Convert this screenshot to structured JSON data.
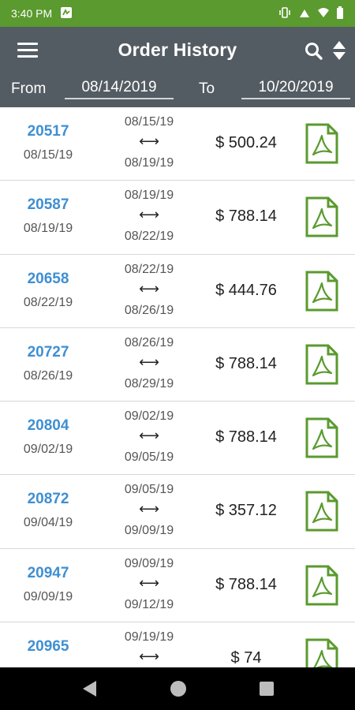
{
  "status_bar": {
    "time": "3:40 PM",
    "icons": [
      "app-notification-icon",
      "vibrate-icon",
      "signal-icon",
      "wifi-icon",
      "battery-icon"
    ]
  },
  "app_bar": {
    "title": "Order History",
    "icons": [
      "menu-icon",
      "search-icon",
      "sort-icon"
    ]
  },
  "filter": {
    "from_label": "From",
    "from_value": "08/14/2019",
    "to_label": "To",
    "to_value": "10/20/2019"
  },
  "orders": [
    {
      "number": "20517",
      "date": "08/15/19",
      "start": "08/15/19",
      "arrow": "⟷",
      "end": "08/19/19",
      "amount": "$ 500.24"
    },
    {
      "number": "20587",
      "date": "08/19/19",
      "start": "08/19/19",
      "arrow": "⟷",
      "end": "08/22/19",
      "amount": "$ 788.14"
    },
    {
      "number": "20658",
      "date": "08/22/19",
      "start": "08/22/19",
      "arrow": "⟷",
      "end": "08/26/19",
      "amount": "$ 444.76"
    },
    {
      "number": "20727",
      "date": "08/26/19",
      "start": "08/26/19",
      "arrow": "⟷",
      "end": "08/29/19",
      "amount": "$ 788.14"
    },
    {
      "number": "20804",
      "date": "09/02/19",
      "start": "09/02/19",
      "arrow": "⟷",
      "end": "09/05/19",
      "amount": "$ 788.14"
    },
    {
      "number": "20872",
      "date": "09/04/19",
      "start": "09/05/19",
      "arrow": "⟷",
      "end": "09/09/19",
      "amount": "$ 357.12"
    },
    {
      "number": "20947",
      "date": "09/09/19",
      "start": "09/09/19",
      "arrow": "⟷",
      "end": "09/12/19",
      "amount": "$ 788.14"
    },
    {
      "number": "20965",
      "date": "",
      "start": "09/19/19",
      "arrow": "⟷",
      "end": "",
      "amount": "$ 74"
    }
  ],
  "colors": {
    "status_bar": "#5a9a2e",
    "app_bar": "#545c63",
    "order_link": "#3f8fd2",
    "pdf_icon": "#5a9a2e"
  },
  "nav_bar": {
    "icons": [
      "back-icon",
      "home-icon",
      "recent-apps-icon"
    ]
  }
}
